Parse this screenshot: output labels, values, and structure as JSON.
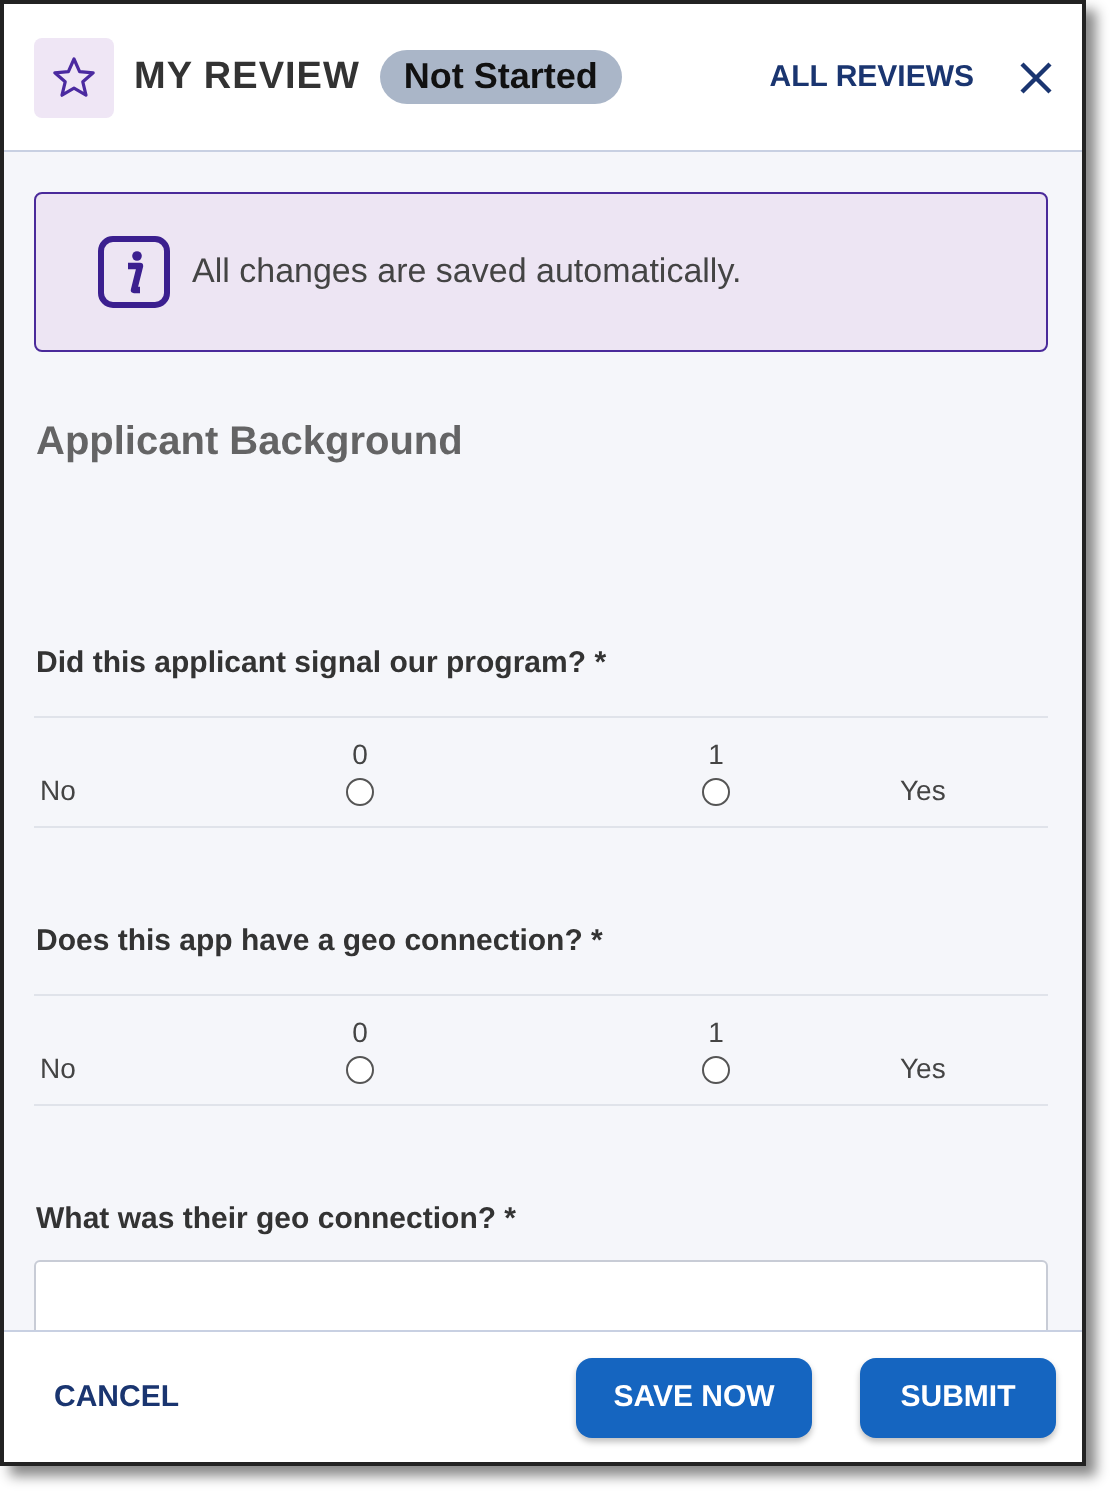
{
  "header": {
    "title": "MY REVIEW",
    "status": "Not Started",
    "link": "ALL REVIEWS"
  },
  "notice": "All changes are saved automatically.",
  "section_title": "Applicant Background",
  "questions": [
    {
      "kind": "scale",
      "label": "Did this applicant signal our program? *",
      "low": "No",
      "high": "Yes",
      "options": [
        {
          "label": "0",
          "selected": false
        },
        {
          "label": "1",
          "selected": false
        }
      ]
    },
    {
      "kind": "scale",
      "label": "Does this app have a geo connection? *",
      "low": "No",
      "high": "Yes",
      "options": [
        {
          "label": "0",
          "selected": false
        },
        {
          "label": "1",
          "selected": false
        }
      ]
    },
    {
      "kind": "text",
      "label": "What was their geo connection? *"
    }
  ],
  "footer": {
    "cancel": "CANCEL",
    "save": "SAVE NOW",
    "submit": "SUBMIT"
  }
}
